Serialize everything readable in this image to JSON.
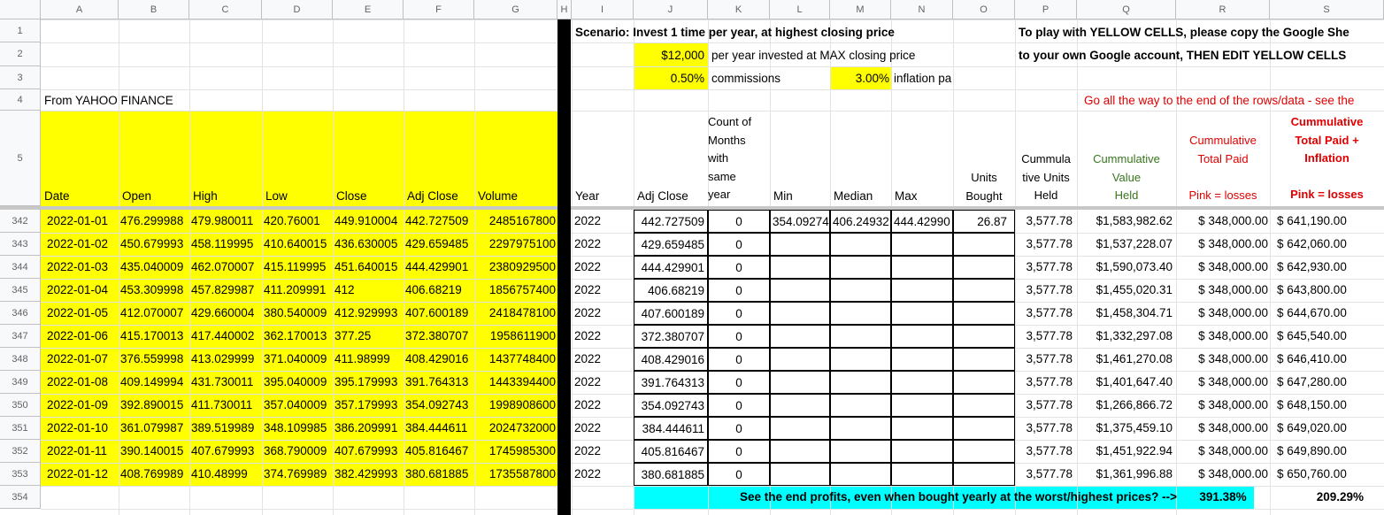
{
  "columns": [
    "A",
    "B",
    "C",
    "D",
    "E",
    "F",
    "G",
    "H",
    "I",
    "J",
    "K",
    "L",
    "M",
    "N",
    "O",
    "P",
    "Q",
    "R",
    "S"
  ],
  "top_rows": [
    "1",
    "2",
    "3",
    "4",
    "5"
  ],
  "data_row_numbers": [
    "342",
    "343",
    "344",
    "345",
    "346",
    "347",
    "348",
    "349",
    "350",
    "351",
    "352",
    "353",
    "354"
  ],
  "scenario": {
    "title": "Scenario:  Invest 1 time per year, at highest closing price",
    "amount": "$12,000",
    "amount_label": "per year invested at MAX closing price",
    "commission": "0.50%",
    "commission_label": "commissions",
    "inflation": "3.00%",
    "inflation_label": "inflation pa"
  },
  "notes": {
    "line1": "To play with YELLOW CELLS, please copy the Google She",
    "line2": "to your own Google account, THEN EDIT YELLOW CELLS",
    "line3": "Go all the way to the end of the rows/data - see the"
  },
  "source_label": "From YAHOO FINANCE",
  "headers": {
    "date": "Date",
    "open": "Open",
    "high": "High",
    "low": "Low",
    "close": "Close",
    "adj_close": "Adj Close",
    "volume": "Volume",
    "year": "Year",
    "adj_close2": "Adj Close",
    "count": [
      "Count of",
      "Months",
      "with",
      "same",
      "year"
    ],
    "min": "Min",
    "median": "Median",
    "max": "Max",
    "units_bought": [
      "Units",
      "Bought"
    ],
    "cum_units": [
      "Cummula",
      "tive Units",
      "Held"
    ],
    "cum_value": [
      "Cummulative",
      "Value",
      "Held"
    ],
    "cum_paid": [
      "Cummulative",
      "Total Paid",
      "",
      "Pink = losses"
    ],
    "cum_infl": [
      "Cummulative",
      "Total Paid +",
      "Inflation",
      "",
      "Pink = losses"
    ]
  },
  "rows": [
    {
      "date": "2022-01-01",
      "open": "476.299988",
      "high": "479.980011",
      "low": "420.76001",
      "close": "449.910004",
      "adj": "442.727509",
      "vol": "2485167800",
      "year": "2022",
      "adj2": "442.727509",
      "count": "0",
      "min": "354.09274",
      "median": "406.24932",
      "max": "444.42990",
      "units": "26.87",
      "cunits": "3,577.78",
      "cvalue": "$1,583,982.62",
      "cpaid": "$ 348,000.00",
      "cinfl": "$  641,190.00"
    },
    {
      "date": "2022-01-02",
      "open": "450.679993",
      "high": "458.119995",
      "low": "410.640015",
      "close": "436.630005",
      "adj": "429.659485",
      "vol": "2297975100",
      "year": "2022",
      "adj2": "429.659485",
      "count": "0",
      "min": "",
      "median": "",
      "max": "",
      "units": "",
      "cunits": "3,577.78",
      "cvalue": "$1,537,228.07",
      "cpaid": "$ 348,000.00",
      "cinfl": "$  642,060.00"
    },
    {
      "date": "2022-01-03",
      "open": "435.040009",
      "high": "462.070007",
      "low": "415.119995",
      "close": "451.640015",
      "adj": "444.429901",
      "vol": "2380929500",
      "year": "2022",
      "adj2": "444.429901",
      "count": "0",
      "min": "",
      "median": "",
      "max": "",
      "units": "",
      "cunits": "3,577.78",
      "cvalue": "$1,590,073.40",
      "cpaid": "$ 348,000.00",
      "cinfl": "$  642,930.00"
    },
    {
      "date": "2022-01-04",
      "open": "453.309998",
      "high": "457.829987",
      "low": "411.209991",
      "close": "412",
      "adj": "406.68219",
      "vol": "1856757400",
      "year": "2022",
      "adj2": "406.68219",
      "count": "0",
      "min": "",
      "median": "",
      "max": "",
      "units": "",
      "cunits": "3,577.78",
      "cvalue": "$1,455,020.31",
      "cpaid": "$ 348,000.00",
      "cinfl": "$  643,800.00"
    },
    {
      "date": "2022-01-05",
      "open": "412.070007",
      "high": "429.660004",
      "low": "380.540009",
      "close": "412.929993",
      "adj": "407.600189",
      "vol": "2418478100",
      "year": "2022",
      "adj2": "407.600189",
      "count": "0",
      "min": "",
      "median": "",
      "max": "",
      "units": "",
      "cunits": "3,577.78",
      "cvalue": "$1,458,304.71",
      "cpaid": "$ 348,000.00",
      "cinfl": "$  644,670.00"
    },
    {
      "date": "2022-01-06",
      "open": "415.170013",
      "high": "417.440002",
      "low": "362.170013",
      "close": "377.25",
      "adj": "372.380707",
      "vol": "1958611900",
      "year": "2022",
      "adj2": "372.380707",
      "count": "0",
      "min": "",
      "median": "",
      "max": "",
      "units": "",
      "cunits": "3,577.78",
      "cvalue": "$1,332,297.08",
      "cpaid": "$ 348,000.00",
      "cinfl": "$  645,540.00"
    },
    {
      "date": "2022-01-07",
      "open": "376.559998",
      "high": "413.029999",
      "low": "371.040009",
      "close": "411.98999",
      "adj": "408.429016",
      "vol": "1437748400",
      "year": "2022",
      "adj2": "408.429016",
      "count": "0",
      "min": "",
      "median": "",
      "max": "",
      "units": "",
      "cunits": "3,577.78",
      "cvalue": "$1,461,270.08",
      "cpaid": "$ 348,000.00",
      "cinfl": "$  646,410.00"
    },
    {
      "date": "2022-01-08",
      "open": "409.149994",
      "high": "431.730011",
      "low": "395.040009",
      "close": "395.179993",
      "adj": "391.764313",
      "vol": "1443394400",
      "year": "2022",
      "adj2": "391.764313",
      "count": "0",
      "min": "",
      "median": "",
      "max": "",
      "units": "",
      "cunits": "3,577.78",
      "cvalue": "$1,401,647.40",
      "cpaid": "$ 348,000.00",
      "cinfl": "$  647,280.00"
    },
    {
      "date": "2022-01-09",
      "open": "392.890015",
      "high": "411.730011",
      "low": "357.040009",
      "close": "357.179993",
      "adj": "354.092743",
      "vol": "1998908600",
      "year": "2022",
      "adj2": "354.092743",
      "count": "0",
      "min": "",
      "median": "",
      "max": "",
      "units": "",
      "cunits": "3,577.78",
      "cvalue": "$1,266,866.72",
      "cpaid": "$ 348,000.00",
      "cinfl": "$  648,150.00"
    },
    {
      "date": "2022-01-10",
      "open": "361.079987",
      "high": "389.519989",
      "low": "348.109985",
      "close": "386.209991",
      "adj": "384.444611",
      "vol": "2024732000",
      "year": "2022",
      "adj2": "384.444611",
      "count": "0",
      "min": "",
      "median": "",
      "max": "",
      "units": "",
      "cunits": "3,577.78",
      "cvalue": "$1,375,459.10",
      "cpaid": "$ 348,000.00",
      "cinfl": "$  649,020.00"
    },
    {
      "date": "2022-01-11",
      "open": "390.140015",
      "high": "407.679993",
      "low": "368.790009",
      "close": "407.679993",
      "adj": "405.816467",
      "vol": "1745985300",
      "year": "2022",
      "adj2": "405.816467",
      "count": "0",
      "min": "",
      "median": "",
      "max": "",
      "units": "",
      "cunits": "3,577.78",
      "cvalue": "$1,451,922.94",
      "cpaid": "$ 348,000.00",
      "cinfl": "$  649,890.00"
    },
    {
      "date": "2022-01-12",
      "open": "408.769989",
      "high": "410.48999",
      "low": "374.769989",
      "close": "382.429993",
      "adj": "380.681885",
      "vol": "1735587800",
      "year": "2022",
      "adj2": "380.681885",
      "count": "0",
      "min": "",
      "median": "",
      "max": "",
      "units": "",
      "cunits": "3,577.78",
      "cvalue": "$1,361,996.88",
      "cpaid": "$ 348,000.00",
      "cinfl": "$  650,760.00"
    }
  ],
  "footer": {
    "text": "See the end profits, even when bought yearly at the worst/highest prices? -->",
    "pct_paid": "391.38%",
    "pct_infl": "209.29%"
  }
}
